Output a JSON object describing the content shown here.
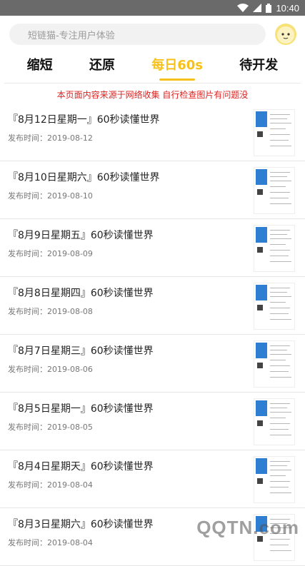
{
  "status": {
    "time": "10:40"
  },
  "search": {
    "placeholder": "短链猫-专注用户体验"
  },
  "tabs": [
    {
      "label": "缩短",
      "active": false
    },
    {
      "label": "还原",
      "active": false
    },
    {
      "label": "每日60s",
      "active": true
    },
    {
      "label": "待开发",
      "active": false
    }
  ],
  "notice": "本页面内容来源于网络收集 自行检查图片有问题没",
  "list": [
    {
      "title": "『8月12日星期一』60秒读懂世界",
      "date": "发布时间：2019-08-12"
    },
    {
      "title": "『8月10日星期六』60秒读懂世界",
      "date": "发布时间：2019-08-10"
    },
    {
      "title": "『8月9日星期五』60秒读懂世界",
      "date": "发布时间：2019-08-09"
    },
    {
      "title": "『8月8日星期四』60秒读懂世界",
      "date": "发布时间：2019-08-08"
    },
    {
      "title": "『8月7日星期三』60秒读懂世界",
      "date": "发布时间：2019-08-06"
    },
    {
      "title": "『8月5日星期一』60秒读懂世界",
      "date": "发布时间：2019-08-05"
    },
    {
      "title": "『8月4日星期天』60秒读懂世界",
      "date": "发布时间：2019-08-04"
    },
    {
      "title": "『8月3日星期六』60秒读懂世界",
      "date": "发布时间：2019-08-04"
    }
  ],
  "colors": {
    "accent": "#f6c11b",
    "notice": "#e0201f",
    "statusbar": "#6a6a6a"
  },
  "watermark": "QQTN.com"
}
